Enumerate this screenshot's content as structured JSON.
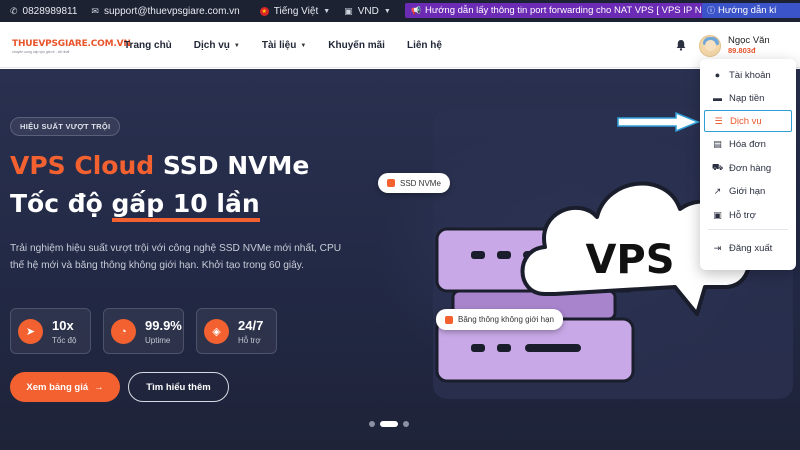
{
  "topbar": {
    "phone": "0828989811",
    "email": "support@thuevpsgiare.com.vn",
    "language": "Tiếng Việt",
    "currency": "VND",
    "promo": "Hướng dẫn lấy thông tin port forwarding cho NAT VPS [ VPS IP Nat ]",
    "promo2": "Hướng dẫn kí"
  },
  "header": {
    "logo": "THUEVPSGIARE.COM.VN",
    "logo_tagline": "chuyên cung cấp vps giá rẻ - tốt nhất",
    "nav": [
      {
        "label": "Trang chủ",
        "dropdown": false
      },
      {
        "label": "Dịch vụ",
        "dropdown": true
      },
      {
        "label": "Tài liệu",
        "dropdown": true
      },
      {
        "label": "Khuyến mãi",
        "dropdown": false
      },
      {
        "label": "Liên hệ",
        "dropdown": false
      }
    ],
    "user_name": "Ngọc Văn",
    "user_balance": "89.803đ"
  },
  "hero": {
    "badge": "HIỆU SUẤT VƯỢT TRỘI",
    "title_orange": "VPS Cloud",
    "title_rest": " SSD NVMe",
    "subtitle_pre": "Tốc độ ",
    "subtitle_ul": "gấp 10 lần",
    "description": "Trải nghiệm hiệu suất vượt trội với công nghệ SSD NVMe mới nhất, CPU thế hệ mới và băng thông không giới hạn. Khởi tạo trong 60 giây.",
    "stats": [
      {
        "value": "10x",
        "label": "Tốc độ",
        "icon": "rocket-icon"
      },
      {
        "value": "99.9%",
        "label": "Uptime",
        "icon": "gauge-icon"
      },
      {
        "value": "24/7",
        "label": "Hỗ trợ",
        "icon": "shield-icon"
      }
    ],
    "btn_primary": "Xem bảng giá",
    "btn_secondary": "Tìm hiểu thêm",
    "chip1": "SSD NVMe",
    "chip2": "Băng thông không giới hạn",
    "cloud_text": "VPS",
    "slides": 3,
    "active_slide": 1
  },
  "dropdown": {
    "items": [
      {
        "label": "Tài khoản",
        "icon": "user-icon"
      },
      {
        "label": "Nạp tiền",
        "icon": "wallet-icon"
      },
      {
        "label": "Dịch vụ",
        "icon": "server-icon",
        "active": true
      },
      {
        "label": "Hóa đơn",
        "icon": "invoice-icon"
      },
      {
        "label": "Đơn hàng",
        "icon": "cart-icon"
      },
      {
        "label": "Giới hạn",
        "icon": "chart-icon"
      },
      {
        "label": "Hỗ trợ",
        "icon": "support-icon"
      },
      {
        "label": "Đăng xuất",
        "icon": "logout-icon"
      }
    ]
  },
  "colors": {
    "accent": "#f2612f",
    "hero_bg": "#232a44",
    "purple": "#6c2bb5",
    "highlight_border": "#2f9fd6"
  }
}
